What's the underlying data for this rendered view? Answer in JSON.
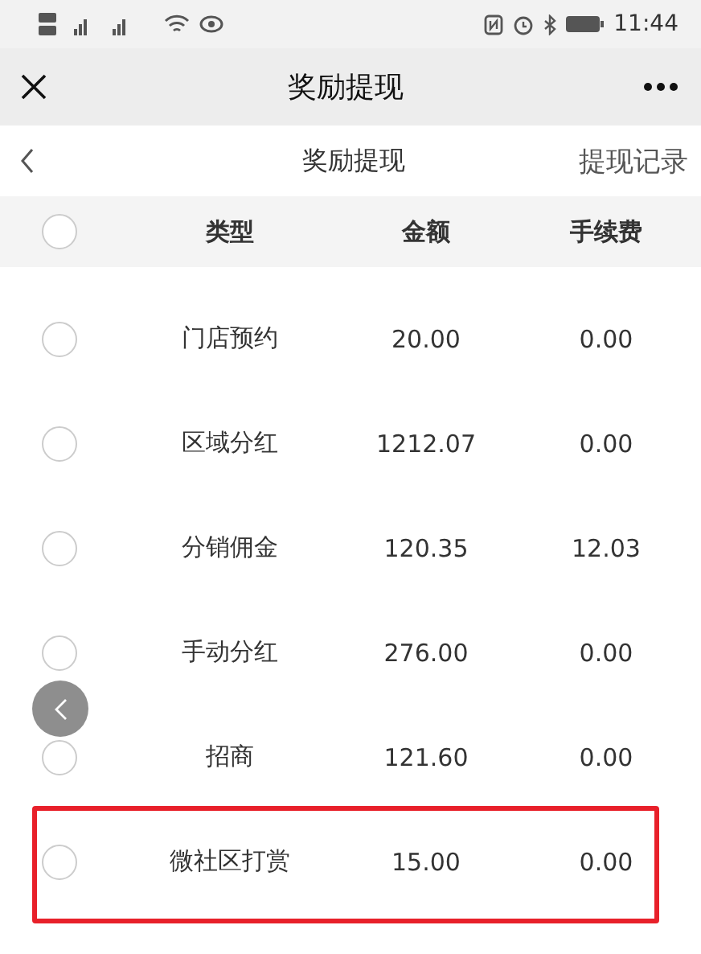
{
  "status_bar": {
    "time": "11:44"
  },
  "nav": {
    "title": "奖励提现"
  },
  "header": {
    "title": "奖励提现",
    "link": "提现记录"
  },
  "table": {
    "select_all": {
      "selected": false
    },
    "columns": [
      "类型",
      "金额",
      "手续费"
    ],
    "rows": [
      {
        "type": "门店预约",
        "amount": "20.00",
        "fee": "0.00",
        "selected": false,
        "highlighted": false
      },
      {
        "type": "区域分红",
        "amount": "1212.07",
        "fee": "0.00",
        "selected": false,
        "highlighted": false
      },
      {
        "type": "分销佣金",
        "amount": "120.35",
        "fee": "12.03",
        "selected": false,
        "highlighted": false
      },
      {
        "type": "手动分红",
        "amount": "276.00",
        "fee": "0.00",
        "selected": false,
        "highlighted": false
      },
      {
        "type": "招商",
        "amount": "121.60",
        "fee": "0.00",
        "selected": false,
        "highlighted": false
      },
      {
        "type": "微社区打赏",
        "amount": "15.00",
        "fee": "0.00",
        "selected": false,
        "highlighted": true
      }
    ]
  }
}
